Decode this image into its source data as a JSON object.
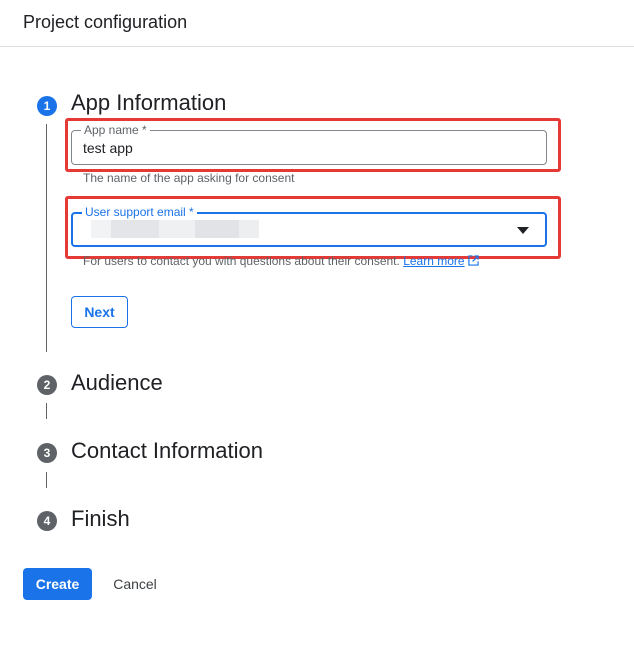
{
  "header": {
    "title": "Project configuration"
  },
  "steps": [
    {
      "number": "1",
      "title": "App Information"
    },
    {
      "number": "2",
      "title": "Audience"
    },
    {
      "number": "3",
      "title": "Contact Information"
    },
    {
      "number": "4",
      "title": "Finish"
    }
  ],
  "app_name": {
    "label": "App name *",
    "value": "test app",
    "hint": "The name of the app asking for consent"
  },
  "support_email": {
    "label": "User support email *",
    "hint": "For users to contact you with questions about their consent.",
    "learn_more": "Learn more"
  },
  "buttons": {
    "next": "Next",
    "create": "Create",
    "cancel": "Cancel"
  },
  "colors": {
    "primary": "#1a73e8",
    "highlight": "#e53935",
    "muted": "#5f6368"
  }
}
